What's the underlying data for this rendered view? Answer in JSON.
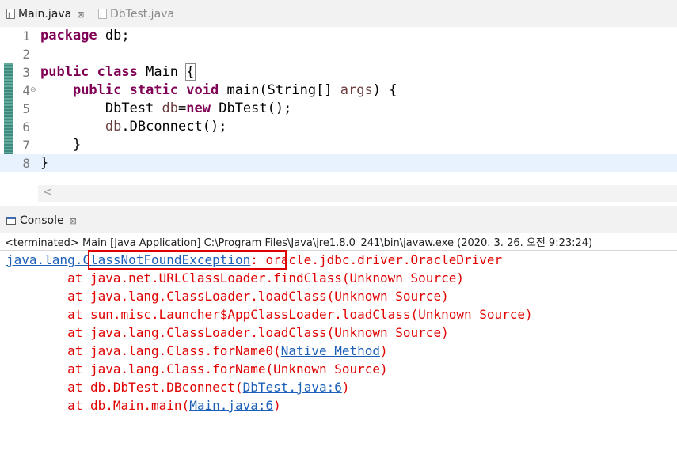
{
  "editor_tabs": [
    {
      "label": "Main.java",
      "close": "⊠",
      "active": true
    },
    {
      "label": "DbTest.java",
      "active": false
    }
  ],
  "code_lines": [
    {
      "num": "1",
      "parts": [
        {
          "t": "package",
          "c": "kw"
        },
        {
          "t": " db;",
          "c": ""
        }
      ]
    },
    {
      "num": "2",
      "parts": []
    },
    {
      "num": "3",
      "parts": [
        {
          "t": "public",
          "c": "kw"
        },
        {
          "t": " ",
          "c": ""
        },
        {
          "t": "class",
          "c": "kw"
        },
        {
          "t": " Main ",
          "c": ""
        },
        {
          "t": "{",
          "c": "brace-box"
        }
      ]
    },
    {
      "num": "4",
      "fold": "⊖",
      "parts": [
        {
          "t": "    ",
          "c": ""
        },
        {
          "t": "public",
          "c": "kw"
        },
        {
          "t": " ",
          "c": ""
        },
        {
          "t": "static",
          "c": "kw"
        },
        {
          "t": " ",
          "c": ""
        },
        {
          "t": "void",
          "c": "kw"
        },
        {
          "t": " main(String[] ",
          "c": ""
        },
        {
          "t": "args",
          "c": "var"
        },
        {
          "t": ") {",
          "c": ""
        }
      ]
    },
    {
      "num": "5",
      "parts": [
        {
          "t": "        DbTest ",
          "c": ""
        },
        {
          "t": "db",
          "c": "var"
        },
        {
          "t": "=",
          "c": ""
        },
        {
          "t": "new",
          "c": "kw"
        },
        {
          "t": " DbTest();",
          "c": ""
        }
      ]
    },
    {
      "num": "6",
      "parts": [
        {
          "t": "        ",
          "c": ""
        },
        {
          "t": "db",
          "c": "var"
        },
        {
          "t": ".DBconnect();",
          "c": ""
        }
      ]
    },
    {
      "num": "7",
      "parts": [
        {
          "t": "    }",
          "c": ""
        }
      ]
    },
    {
      "num": "8",
      "parts": [
        {
          "t": "}",
          "c": ""
        }
      ],
      "highlight": true
    }
  ],
  "scroll_left_glyph": "<",
  "console": {
    "tab_label": "Console",
    "tab_close": "⊠",
    "header": "<terminated> Main [Java Application] C:\\Program Files\\Java\\jre1.8.0_241\\bin\\javaw.exe (2020. 3. 26. 오전 9:23:24)",
    "lines": [
      [
        {
          "t": "java.lang.",
          "c": "link"
        },
        {
          "t": "ClassNotFoundException",
          "c": "link"
        },
        {
          "t": ": oracle.jdbc.driver.OracleDriver",
          "c": ""
        }
      ],
      [
        {
          "t": "\tat java.net.URLClassLoader.findClass(Unknown Source)",
          "c": ""
        }
      ],
      [
        {
          "t": "\tat java.lang.ClassLoader.loadClass(Unknown Source)",
          "c": ""
        }
      ],
      [
        {
          "t": "\tat sun.misc.Launcher$AppClassLoader.loadClass(Unknown Source)",
          "c": ""
        }
      ],
      [
        {
          "t": "\tat java.lang.ClassLoader.loadClass(Unknown Source)",
          "c": ""
        }
      ],
      [
        {
          "t": "\tat java.lang.Class.forName0(",
          "c": ""
        },
        {
          "t": "Native Method",
          "c": "link"
        },
        {
          "t": ")",
          "c": ""
        }
      ],
      [
        {
          "t": "\tat java.lang.Class.forName(Unknown Source)",
          "c": ""
        }
      ],
      [
        {
          "t": "\tat db.DbTest.DBconnect(",
          "c": ""
        },
        {
          "t": "DbTest.java:6",
          "c": "link"
        },
        {
          "t": ")",
          "c": ""
        }
      ],
      [
        {
          "t": "\tat db.Main.main(",
          "c": ""
        },
        {
          "t": "Main.java:6",
          "c": "link"
        },
        {
          "t": ")",
          "c": ""
        }
      ]
    ]
  },
  "colors": {
    "keyword": "#7f0055",
    "error": "#e00000",
    "link": "#1b5fb8",
    "annotation_box": "#e00000"
  }
}
